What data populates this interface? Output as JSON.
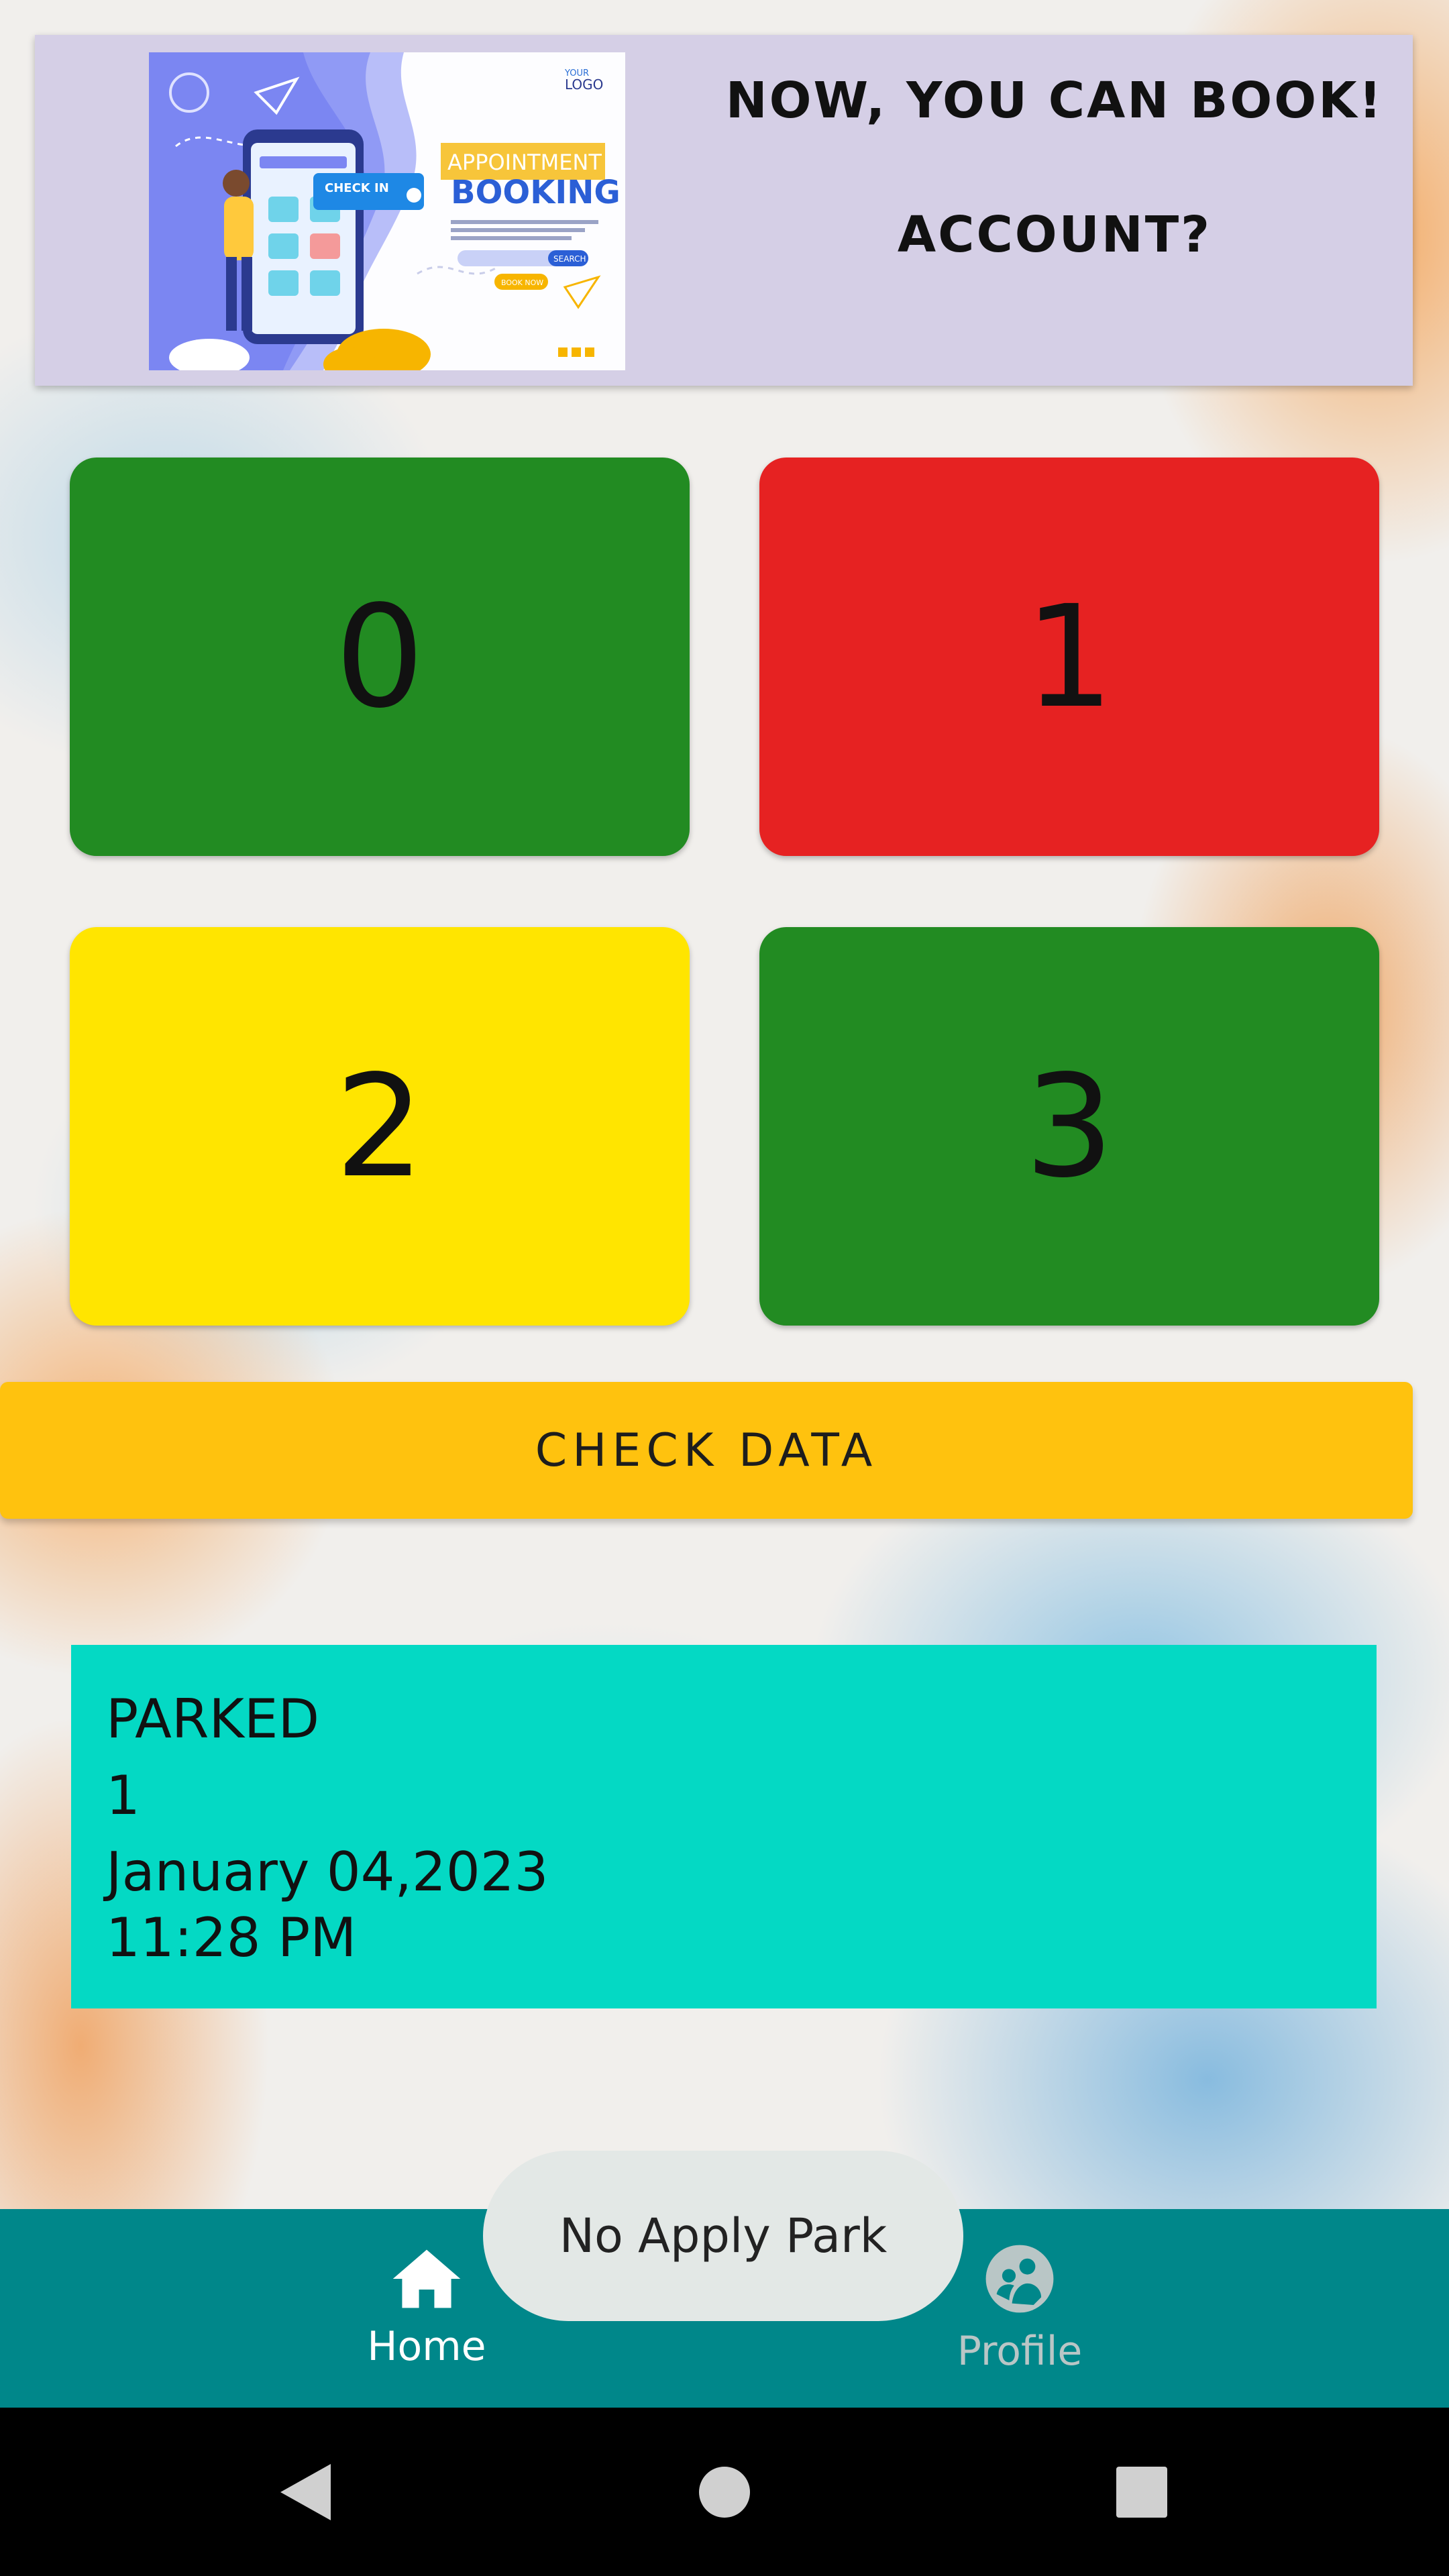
{
  "banner": {
    "line1": "NOW, YOU CAN BOOK!",
    "line2": "ACCOUNT?",
    "image": {
      "logo_small": "YOUR",
      "logo": "LOGO",
      "title_line1": "APPOINTMENT",
      "title_line2": "BOOKING",
      "check_in": "CHECK IN",
      "search": "SEARCH",
      "book_now": "BOOK NOW"
    }
  },
  "slots": [
    {
      "label": "0",
      "color": "#228b22"
    },
    {
      "label": "1",
      "color": "#e62222"
    },
    {
      "label": "2",
      "color": "#ffe500"
    },
    {
      "label": "3",
      "color": "#228b22"
    }
  ],
  "check_button": {
    "label": "CHECK DATA",
    "color": "#ffc20e"
  },
  "info": {
    "status": "PARKED",
    "slot": "1",
    "date": "January 04,2023",
    "time": "11:28 PM",
    "color": "#04d9c4"
  },
  "toast": {
    "message": "No Apply Park"
  },
  "bottom_nav": {
    "items": [
      {
        "label": "Home",
        "icon": "home-icon",
        "active": true
      },
      {
        "label": "Profile",
        "icon": "profile-icon",
        "active": false
      }
    ],
    "color": "#00878a"
  },
  "system_nav": {
    "back": "back-icon",
    "home": "home-circle-icon",
    "recents": "recents-icon"
  }
}
